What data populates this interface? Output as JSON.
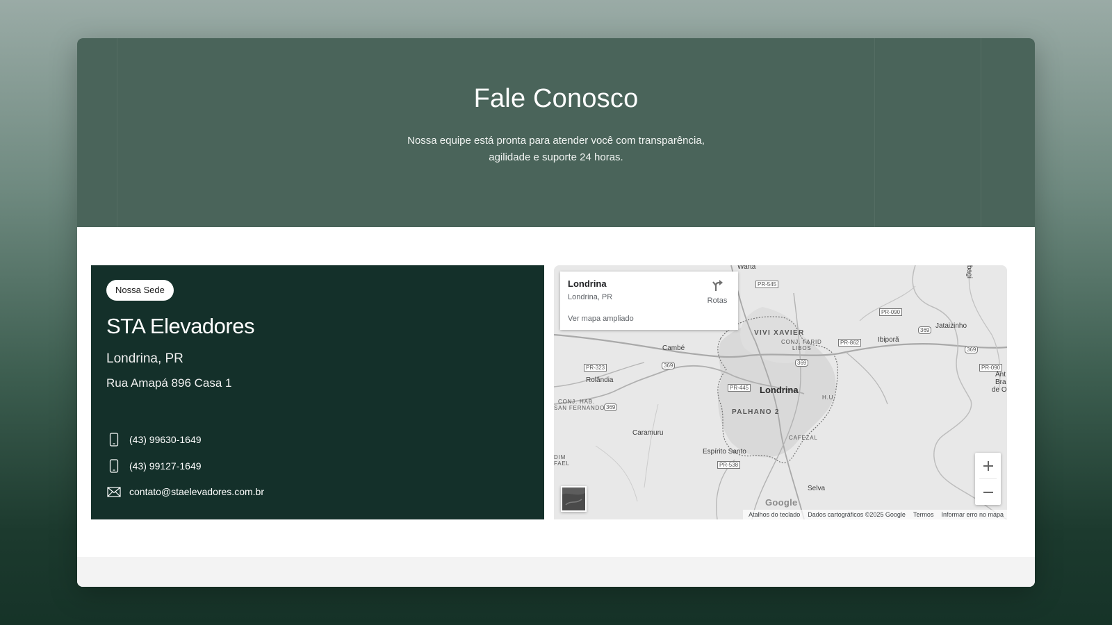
{
  "hero": {
    "title": "Fale Conosco",
    "subtitle_line1": "Nossa equipe está pronta para atender você com transparência,",
    "subtitle_line2": "agilidade e suporte 24 horas."
  },
  "contact": {
    "badge": "Nossa Sede",
    "company": "STA Elevadores",
    "city": "Londrina, PR",
    "street": "Rua Amapá 896 Casa 1",
    "phone1": "(43) 99630-1649",
    "phone2": "(43) 99127-1649",
    "email": "contato@staelevadores.com.br",
    "icons": [
      "phone-icon",
      "phone-icon",
      "mail-icon"
    ]
  },
  "map": {
    "place_name": "Londrina",
    "place_sub": "Londrina, PR",
    "directions_label": "Rotas",
    "larger_map_link": "Ver mapa ampliado",
    "zoom_in": "+",
    "zoom_out": "−",
    "google_logo": "Google",
    "attribution": {
      "shortcuts": "Atalhos do teclado",
      "data": "Dados cartográficos ©2025 Google",
      "terms": "Termos",
      "report": "Informar erro no mapa"
    },
    "labels": {
      "londrina": "Londrina",
      "vivi_xavier": "VIVI XAVIER",
      "conj_farid": "CONJ. FARID",
      "libos": "LIBOS",
      "palhano": "PALHANO 2",
      "cafezal": "CAFEZAL",
      "hu": "H.U.",
      "cambe": "Cambé",
      "rolandia": "Rolândia",
      "conj_hab": "CONJ. HAB.",
      "san_fernando": "SAN FERNANDO",
      "caramuru": "Caramuru",
      "espirito_santo": "Espírito Santo",
      "selva": "Selva",
      "ibipora": "Ibiporã",
      "jataizinho": "Jataizinho",
      "warta": "Warta",
      "dim": "DIM",
      "fael": "FAEL",
      "ant": "Ant",
      "bra": "Bra",
      "de_o": "de O",
      "tibagi": "Tibagi",
      "pr545": "PR-545",
      "pr090a": "PR-090",
      "pr090b": "PR-090",
      "pr862": "PR-862",
      "pr323": "PR-323",
      "pr445": "PR-445",
      "pr538": "PR-538",
      "r369a": "369",
      "r369b": "369",
      "r369c": "369",
      "r369d": "369",
      "r369e": "369"
    }
  },
  "colors": {
    "hero_bg": "#4a645a",
    "panel_bg": "#14302a",
    "card_bg": "#ffffff"
  }
}
